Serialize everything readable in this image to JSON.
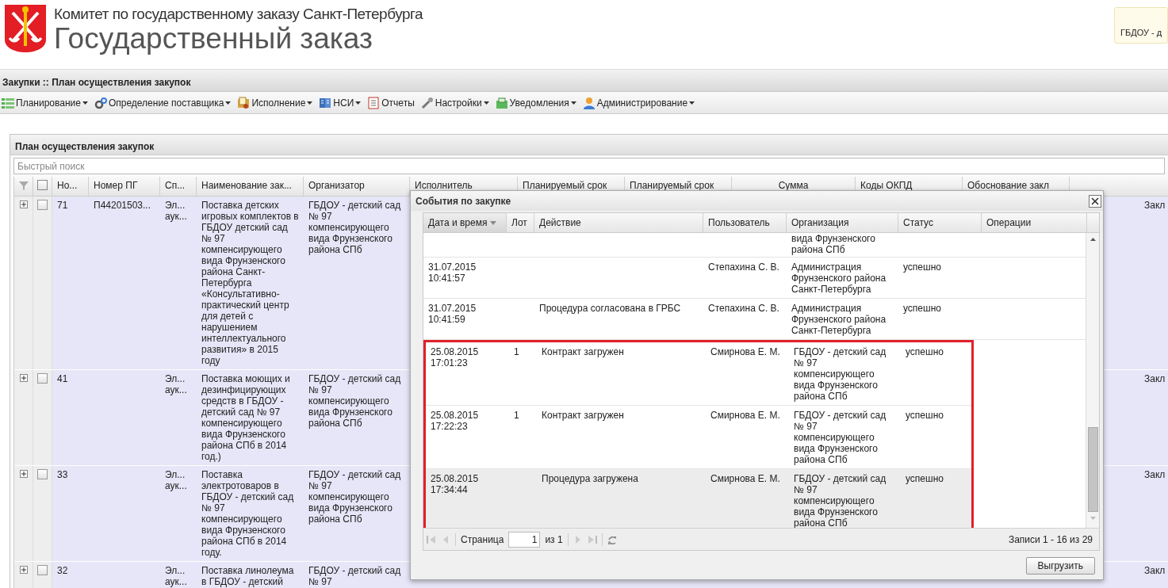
{
  "header": {
    "org_line": "Комитет по государственному заказу Санкт-Петербурга",
    "title": "Государственный заказ",
    "user_box": "ГБДОУ - д"
  },
  "breadcrumb": "Закупки :: План осуществления закупок",
  "menu": [
    {
      "label": "Планирование",
      "kind": "list",
      "dropdown": true
    },
    {
      "label": "Определение поставщика",
      "kind": "gears",
      "dropdown": true
    },
    {
      "label": "Исполнение",
      "kind": "folder",
      "dropdown": true
    },
    {
      "label": "НСИ",
      "kind": "book",
      "dropdown": true
    },
    {
      "label": "Отчеты",
      "kind": "report",
      "dropdown": false
    },
    {
      "label": "Настройки",
      "kind": "wrench",
      "dropdown": true
    },
    {
      "label": "Уведомления",
      "kind": "inbox",
      "dropdown": true
    },
    {
      "label": "Администрирование",
      "kind": "person",
      "dropdown": true
    }
  ],
  "panel": {
    "title": "План осуществления закупок",
    "search": {
      "placeholder": "Быстрый поиск"
    },
    "select_all": {
      "checked": false
    },
    "columns": [
      "Но...",
      "Номер ПГ",
      "Сп...",
      "Наименование зак...",
      "Организатор",
      "Исполнитель",
      "Планируемый срок",
      "Планируемый срок",
      "Сумма",
      "Коды ОКПД",
      "Обоснование закл"
    ],
    "rows": [
      {
        "expanded": false,
        "checked": false,
        "number": "71",
        "plan_number": "П44201503...",
        "method": "Эл... аук...",
        "name": "Поставка детских игровых комплектов в ГБДОУ детский сад № 97 компенсирующего вида Фрунзенского района Санкт-Петербурга «Консультативно-практический центр для детей с нарушением интеллектуального развития» в 2015 году",
        "organizer": "ГБДОУ - детский сад № 97 компенсирующего вида Фрунзенского района СПб",
        "column_14": "Закл"
      },
      {
        "expanded": false,
        "checked": false,
        "number": "41",
        "method": "Эл... аук...",
        "name": "Поставка моющих и дезинфицирующих средств в ГБДОУ - детский сад № 97 компенсирующего вида Фрунзенского района СПб в 2014 год.)",
        "organizer": "ГБДОУ - детский сад № 97 компенсирующего вида Фрунзенского района СПб",
        "column_14": "Закл"
      },
      {
        "expanded": false,
        "checked": false,
        "number": "33",
        "method": "Эл... аук...",
        "name": "Поставка электротоваров в ГБДОУ - детский сад № 97 компенсирующего вида Фрунзенского района СПб в 2014 году.",
        "organizer": "ГБДОУ - детский сад № 97 компенсирующего вида Фрунзенского района СПб",
        "column_14": "Закл"
      },
      {
        "expanded": false,
        "checked": false,
        "number": "32",
        "method": "Эл... аук...",
        "name": "Поставка линолеума в ГБДОУ - детский",
        "organizer": "ГБДОУ - детский сад № 97",
        "column_14": "Закл"
      }
    ]
  },
  "dialog": {
    "title": "События по закупке",
    "columns": [
      {
        "label": "Дата и время",
        "sorted": true
      },
      {
        "label": "Лот",
        "sorted": false
      },
      {
        "label": "Действие",
        "sorted": false
      },
      {
        "label": "Пользователь",
        "sorted": false
      },
      {
        "label": "Организация",
        "sorted": false
      },
      {
        "label": "Статус",
        "sorted": false
      },
      {
        "label": "Операции",
        "sorted": false
      }
    ],
    "rows": [
      {
        "partial": true,
        "selected": false,
        "highlighted": false,
        "organization": "вида Фрунзенского района СПб"
      },
      {
        "partial": false,
        "selected": false,
        "highlighted": false,
        "datetime": "31.07.2015 10:41:57",
        "user": "Степахина С. В.",
        "organization": "Администрация Фрунзенского района Санкт-Петербурга",
        "status": "успешно"
      },
      {
        "partial": false,
        "selected": false,
        "highlighted": false,
        "datetime": "31.07.2015 10:41:59",
        "action": "Процедура согласована в ГРБС",
        "user": "Степахина С. В.",
        "organization": "Администрация Фрунзенского района Санкт-Петербурга",
        "status": "успешно"
      },
      {
        "partial": false,
        "selected": false,
        "highlighted": true,
        "datetime": "25.08.2015 17:01:23",
        "lot": "1",
        "action": "Контракт загружен",
        "user": "Смирнова Е. М.",
        "organization": "ГБДОУ - детский сад № 97 компенсирующего вида Фрунзенского района СПб",
        "status": "успешно"
      },
      {
        "partial": false,
        "selected": false,
        "highlighted": true,
        "datetime": "25.08.2015 17:22:23",
        "lot": "1",
        "action": "Контракт загружен",
        "user": "Смирнова Е. М.",
        "organization": "ГБДОУ - детский сад № 97 компенсирующего вида Фрунзенского района СПб",
        "status": "успешно"
      },
      {
        "partial": false,
        "selected": true,
        "highlighted": true,
        "datetime": "25.08.2015 17:34:44",
        "action": "Процедура загружена",
        "user": "Смирнова Е. М.",
        "organization": "ГБДОУ - детский сад № 97 компенсирующего вида Фрунзенского района СПб",
        "status": "успешно"
      }
    ],
    "pager": {
      "page_label": "Страница",
      "page": "1",
      "of": "из 1",
      "records": "Записи 1 - 16 из 29"
    },
    "export_button": "Выгрузить"
  }
}
